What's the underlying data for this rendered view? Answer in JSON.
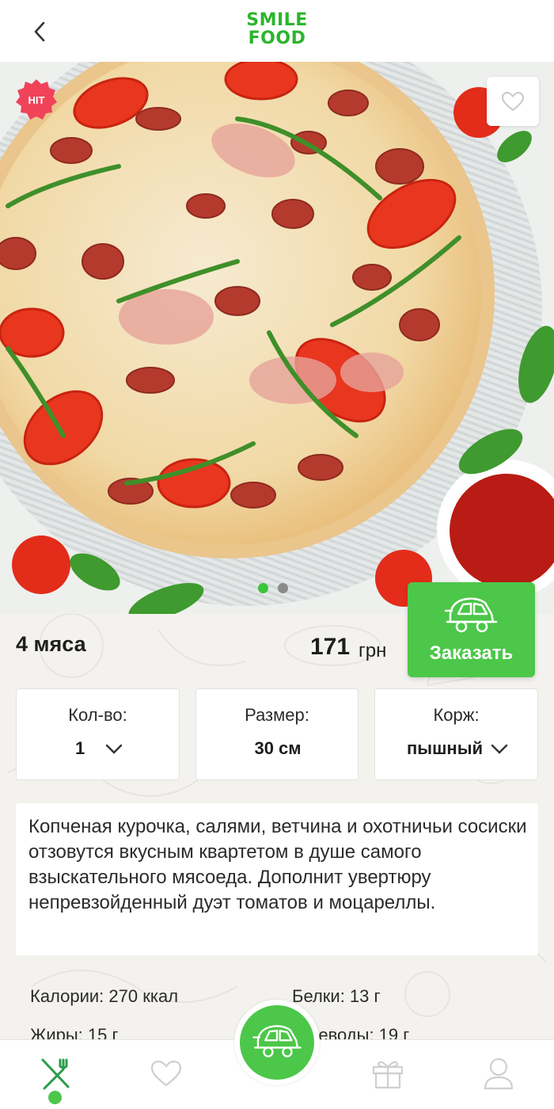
{
  "header": {
    "back_icon": "chevron-left-icon",
    "logo_line1": "SMILE",
    "logo_line2": "FOOD",
    "logo_color": "#2cb52c"
  },
  "hero": {
    "image_description_icon": "pizza-photo",
    "badge": "HIT",
    "badge_color": "#f0435a",
    "favorite_icon": "heart-outline-icon",
    "slides": {
      "total": 2,
      "active": 1
    }
  },
  "product": {
    "name": "4 мяса",
    "price": "171",
    "currency": "грн"
  },
  "order_button": {
    "label": "Заказать",
    "icon": "delivery-car-icon",
    "color": "#4cc749"
  },
  "options": {
    "quantity": {
      "label": "Кол-во:",
      "value": "1"
    },
    "size": {
      "label": "Размер:",
      "value": "30 см"
    },
    "crust": {
      "label": "Корж:",
      "value": "пышный"
    }
  },
  "description": "Копченая курочка, салями, ветчина и охотничьи сосиски отзовутся вкусным квартетом в душе самого взыскательного мясоеда. Дополнит увертюру непревзойденный дуэт томатов и моцареллы.",
  "nutrition": {
    "calories": "Калории: 270 ккал",
    "proteins": "Белки: 13 г",
    "fats": "Жиры: 15 г",
    "carbs": "Углеводы: 19 г"
  },
  "bottom_nav": {
    "items": [
      {
        "icon": "menu-cutlery-icon",
        "active": true
      },
      {
        "icon": "heart-icon",
        "active": false
      },
      {
        "icon": "delivery-car-icon",
        "active": false
      },
      {
        "icon": "gift-icon",
        "active": false
      },
      {
        "icon": "profile-icon",
        "active": false
      }
    ],
    "accent_color": "#4cc749"
  }
}
